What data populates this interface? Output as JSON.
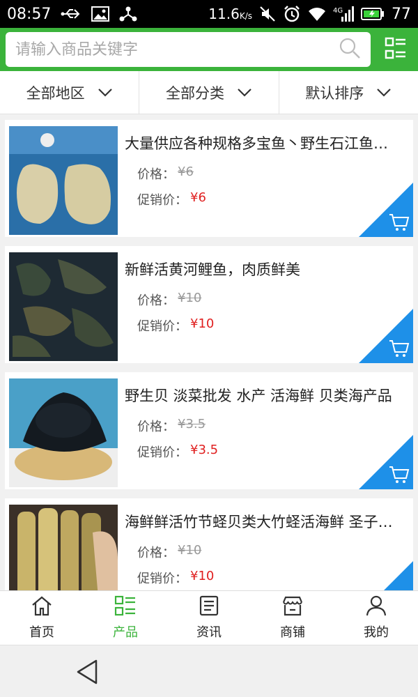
{
  "status_bar": {
    "time": "08:57",
    "speed": "11.6",
    "speed_unit": "K/s",
    "network": "4G",
    "battery": "77"
  },
  "search": {
    "placeholder": "请输入商品关键字"
  },
  "filters": [
    {
      "label": "全部地区"
    },
    {
      "label": "全部分类"
    },
    {
      "label": "默认排序"
    }
  ],
  "labels": {
    "price": "价格：",
    "promo": "促销价："
  },
  "products": [
    {
      "title": "大量供应各种规格多宝鱼丶野生石江鱼…",
      "price": "¥6",
      "promo_price": "¥6"
    },
    {
      "title": "新鲜活黄河鲤鱼，肉质鲜美",
      "price": "¥10",
      "promo_price": "¥10"
    },
    {
      "title": "野生贝 淡菜批发 水产 活海鲜 贝类海产品",
      "price": "¥3.5",
      "promo_price": "¥3.5"
    },
    {
      "title": "海鲜鲜活竹节蛏贝类大竹蛏活海鲜 圣子…",
      "price": "¥10",
      "promo_price": "¥10"
    }
  ],
  "bottom_nav": [
    {
      "label": "首页",
      "icon": "home-icon"
    },
    {
      "label": "产品",
      "icon": "list-icon",
      "active": true
    },
    {
      "label": "资讯",
      "icon": "news-icon"
    },
    {
      "label": "商铺",
      "icon": "shop-icon"
    },
    {
      "label": "我的",
      "icon": "user-icon"
    }
  ],
  "colors": {
    "brand": "#3bb33b",
    "promo": "#e02020",
    "cart_corner": "#1e90e8"
  }
}
